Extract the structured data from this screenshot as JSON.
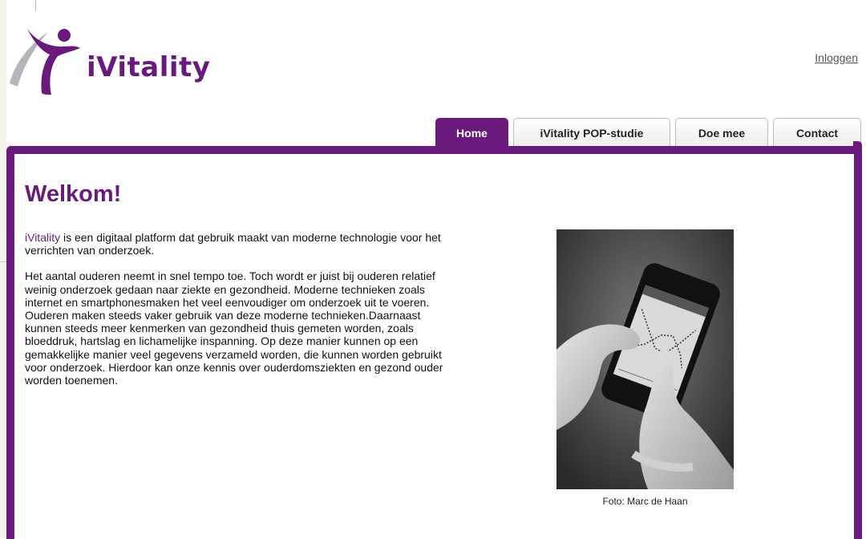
{
  "header": {
    "logo_text": "iVitality",
    "login_label": "Inloggen"
  },
  "nav": {
    "tabs": [
      {
        "label": "Home",
        "active": true
      },
      {
        "label": "iVitality POP-studie",
        "active": false
      },
      {
        "label": "Doe mee",
        "active": false
      },
      {
        "label": "Contact",
        "active": false
      }
    ]
  },
  "main": {
    "heading": "Welkom!",
    "intro_link": "iVitality",
    "intro_rest": " is een digitaal platform dat gebruik maakt van moderne technologie voor het verrichten van onderzoek.",
    "body": "Het aantal ouderen neemt in snel tempo toe. Toch wordt er juist bij ouderen relatief weinig onderzoek gedaan naar ziekte en gezondheid. Moderne technieken zoals internet en smartphonesmaken het veel eenvoudiger om onderzoek uit te voeren. Ouderen maken steeds vaker gebruik van deze moderne technieken.Daarnaast kunnen steeds meer kenmerken van gezondheid thuis gemeten worden, zoals bloeddruk, hartslag en lichamelijke inspanning. Op deze manier kunnen op een gemakkelijke manier veel gegevens verzameld worden, die kunnen worden gebruikt voor onderzoek. Hierdoor kan onze kennis over ouderdomsziekten en gezond ouder worden toenemen.",
    "photo_caption": "Foto: Marc de Haan"
  },
  "colors": {
    "brand": "#6a1a7d",
    "logo_grey": "#b4b6b9"
  },
  "icons": {
    "logo": "ivitality-swoosh-logo"
  }
}
